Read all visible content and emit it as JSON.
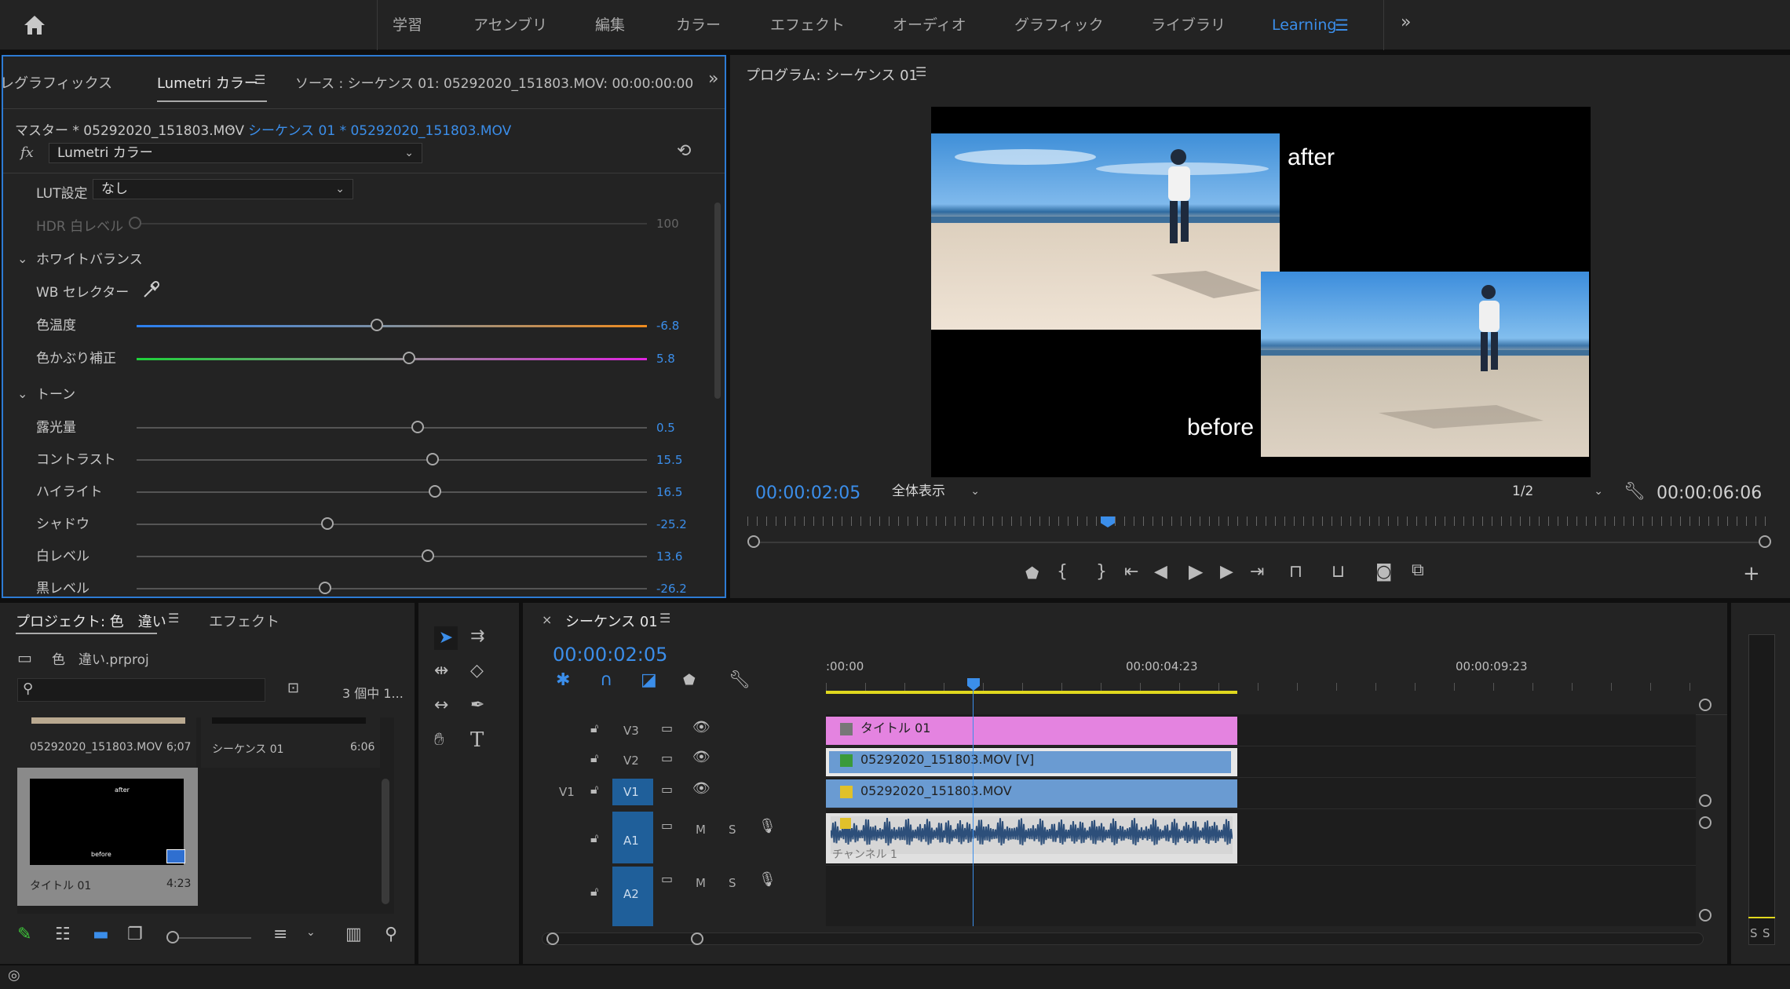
{
  "topbar": {
    "workspaces": [
      "学習",
      "アセンブリ",
      "編集",
      "カラー",
      "エフェクト",
      "オーディオ",
      "グラフィック",
      "ライブラリ",
      "Learning"
    ],
    "active": "Learning"
  },
  "lumetri": {
    "tabs": [
      "レグラフィックス",
      "Lumetri カラー",
      "ソース : シーケンス 01: 05292020_151803.MOV: 00:00:00:00"
    ],
    "master": "マスター * 05292020_151803.MOV",
    "sequence": "シーケンス 01 * 05292020_151803.MOV",
    "fx_label": "fx",
    "effect": "Lumetri カラー",
    "lut_label": "LUT設定",
    "lut_value": "なし",
    "hdr_label": "HDR 白レベル",
    "hdr_value": "100",
    "wb_section": "ホワイトバランス",
    "wb_selector": "WB セレクター",
    "temp_label": "色温度",
    "temp_value": "-6.8",
    "tint_label": "色かぶり補正",
    "tint_value": "5.8",
    "tone_section": "トーン",
    "tone": [
      {
        "label": "露光量",
        "value": "0.5",
        "pos": 0.55
      },
      {
        "label": "コントラスト",
        "value": "15.5",
        "pos": 0.58
      },
      {
        "label": "ハイライト",
        "value": "16.5",
        "pos": 0.585
      },
      {
        "label": "シャドウ",
        "value": "-25.2",
        "pos": 0.374
      },
      {
        "label": "白レベル",
        "value": "13.6",
        "pos": 0.57
      },
      {
        "label": "黒レベル",
        "value": "-26.2",
        "pos": 0.369
      }
    ],
    "temp_pos": 0.47,
    "tint_pos": 0.534
  },
  "program": {
    "title": "プログラム: シーケンス 01",
    "after": "after",
    "before": "before",
    "timecode": "00:00:02:05",
    "fit": "全体表示",
    "quality": "1/2",
    "duration": "00:00:06:06"
  },
  "project": {
    "title": "プロジェクト: 色　違い",
    "effects_tab": "エフェクト",
    "file": "色　違い.prproj",
    "count": "3 個中 1...",
    "items": [
      {
        "name": "05292020_151803.MOV",
        "dur": "6;07"
      },
      {
        "name": "シーケンス 01",
        "dur": "6:06"
      },
      {
        "name": "タイトル 01",
        "dur": "4:23"
      }
    ],
    "thumb_after": "after",
    "thumb_before": "before"
  },
  "timeline": {
    "title": "シーケンス 01",
    "timecode": "00:00:02:05",
    "ruler": [
      ":00:00",
      "00:00:04:23",
      "00:00:09:23"
    ],
    "tracks": {
      "v3": "V3",
      "v2": "V2",
      "v1": "V1",
      "v1src": "V1",
      "a1": "A1",
      "a2": "A2"
    },
    "m": "M",
    "s": "S",
    "clip_title": "タイトル 01",
    "clip_v2": "05292020_151803.MOV [V]",
    "clip_v1": "05292020_151803.MOV",
    "clip_audio_label": "チャンネル 1"
  },
  "meter": {
    "s1": "S",
    "s2": "S"
  }
}
